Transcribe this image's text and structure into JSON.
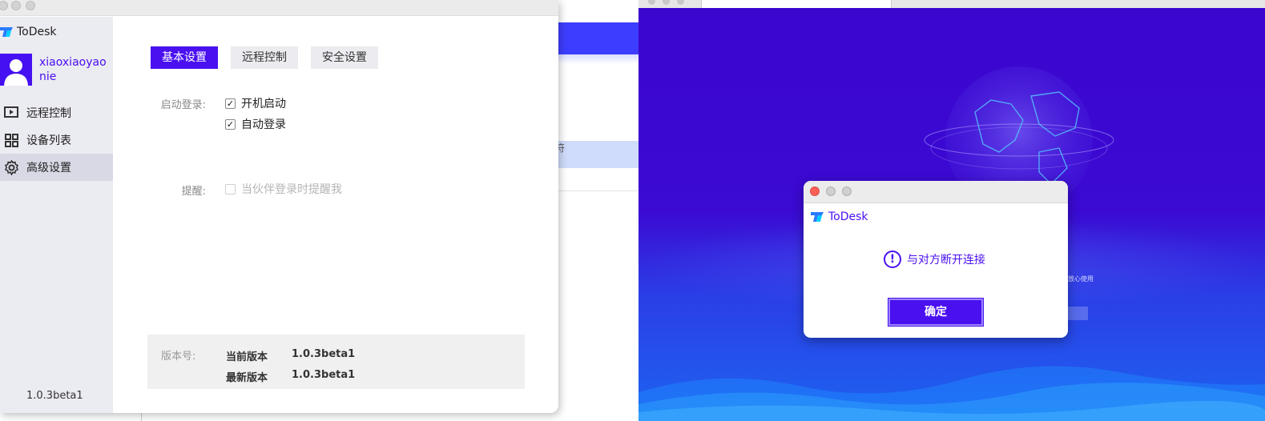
{
  "app": {
    "name": "ToDesk",
    "brand_color": "#4a10f0"
  },
  "sidebar": {
    "username": "xiaoxiaoyaonie",
    "items": [
      {
        "label": "远程控制",
        "icon": "remote-control-icon"
      },
      {
        "label": "设备列表",
        "icon": "grid-icon"
      },
      {
        "label": "高级设置",
        "icon": "gear-icon",
        "active": true
      }
    ],
    "version": "1.0.3beta1"
  },
  "tabs": [
    {
      "label": "基本设置",
      "active": true
    },
    {
      "label": "远程控制",
      "active": false
    },
    {
      "label": "安全设置",
      "active": false
    }
  ],
  "settings": {
    "startup_label": "启动登录:",
    "auto_start": {
      "label": "开机启动",
      "checked": true
    },
    "auto_login": {
      "label": "自动登录",
      "checked": true
    },
    "reminder_label": "提醒:",
    "partner_login_alert": {
      "label": "当伙伴登录时提醒我",
      "checked": false,
      "disabled": true
    }
  },
  "version_info": {
    "label": "版本号:",
    "current_key": "当前版本",
    "current_value": "1.0.3beta1",
    "latest_key": "最新版本",
    "latest_value": "1.0.3beta1"
  },
  "background": {
    "fragment_text": "符",
    "remote_fragment_text": "放心使用"
  },
  "dialog": {
    "title": "ToDesk",
    "message": "与对方断开连接",
    "ok_label": "确定"
  }
}
